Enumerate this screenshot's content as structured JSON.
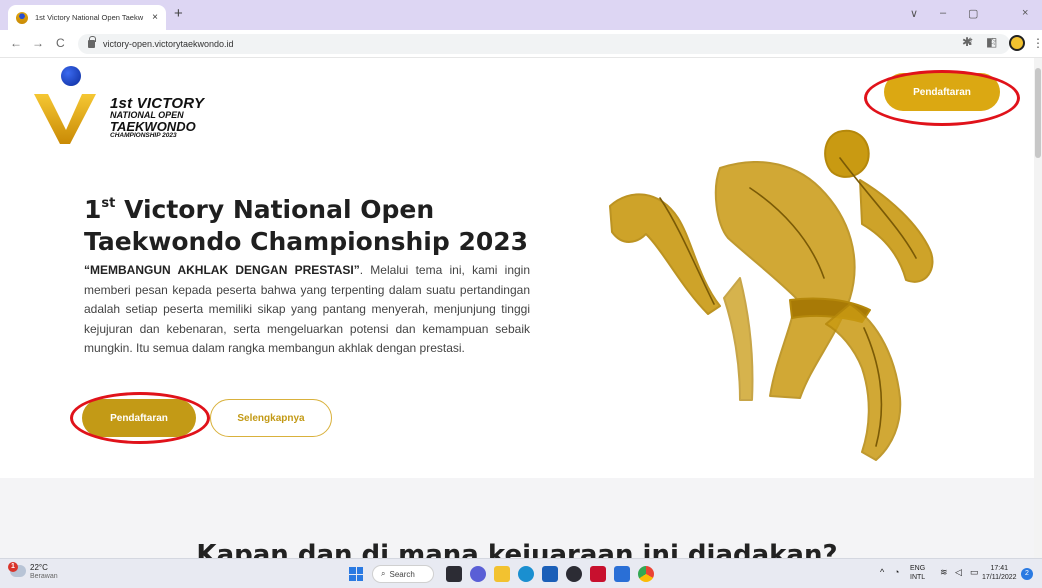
{
  "browser": {
    "tab_title": "1st Victory National Open Taekw",
    "tab_close": "×",
    "new_tab": "+",
    "url": "victory-open.victorytaekwondo.id",
    "controls": {
      "collapse": "∨",
      "minimize": "–",
      "maximize": "▢",
      "close": "×"
    }
  },
  "logo": {
    "line1": "1st VICTORY",
    "line2": "NATIONAL OPEN",
    "line3": "TAEKWONDO",
    "line4": "CHAMPIONSHIP 2023"
  },
  "header": {
    "register_button": "Pendaftaran"
  },
  "hero": {
    "title_num": "1",
    "title_sup": "st",
    "title_rest": " Victory National Open Taekwondo Championship 2023",
    "tagline": "“MEMBANGUN AKHLAK DENGAN PRESTASI”",
    "description": ". Melalui tema ini, kami ingin memberi pesan kepada peserta bahwa yang terpenting dalam suatu pertandingan adalah setiap peserta memiliki sikap yang pantang menyerah, menjunjung tinggi kejujuran dan kebenaran, serta mengeluarkan potensi dan kemampuan sebaik mungkin. Itu semua dalam rangka membangun akhlak dengan prestasi.",
    "register_button": "Pendaftaran",
    "more_button": "Selengkapnya"
  },
  "section2": {
    "heading": "Kapan dan di mana kejuaraan ini diadakan?"
  },
  "taskbar": {
    "weather_badge": "1",
    "temp": "22°C",
    "weather": "Berawan",
    "search": "Search",
    "lang1": "ENG",
    "lang2": "INTL",
    "time": "17:41",
    "date": "17/11/2022",
    "notifications": "2"
  },
  "colors": {
    "gold": "#c39a16",
    "gold_bright": "#dba812",
    "highlight_ring": "#e0121a",
    "tab_bar": "#ddd6f3"
  }
}
